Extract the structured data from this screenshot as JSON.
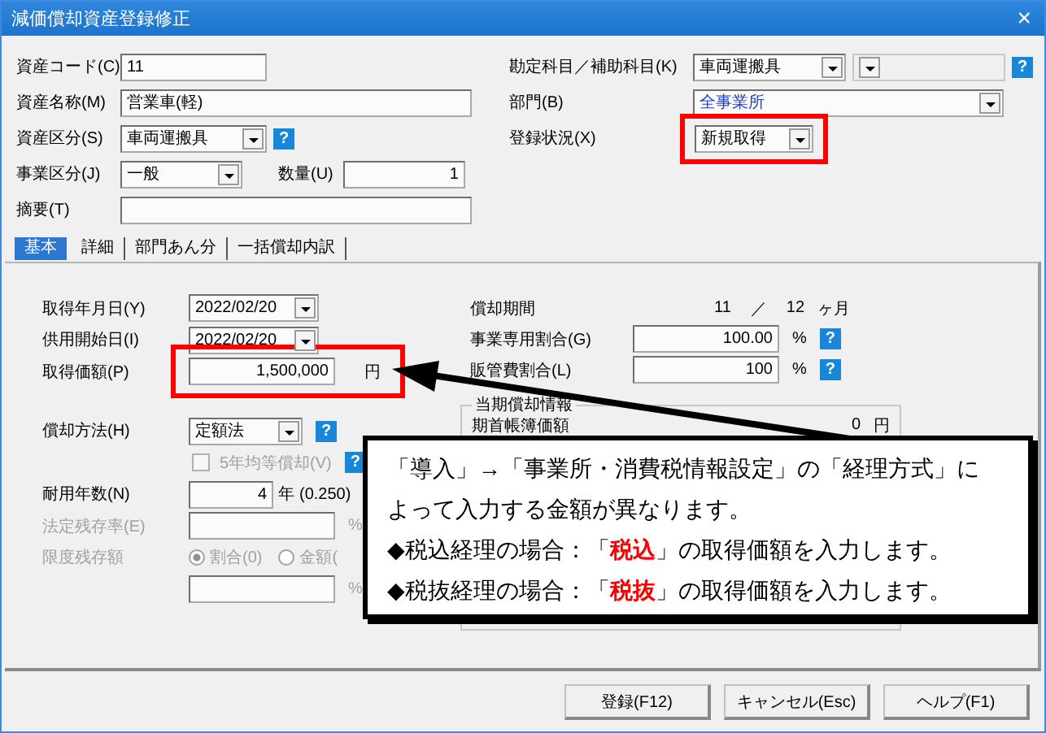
{
  "window": {
    "title": "減価償却資産登録修正",
    "close": "×"
  },
  "help_mark": "?",
  "form": {
    "asset_code": {
      "label": "資産コード(C)",
      "value": "11"
    },
    "asset_name": {
      "label": "資産名称(M)",
      "value": "営業車(軽)"
    },
    "asset_class": {
      "label": "資産区分(S)",
      "value": "車両運搬具"
    },
    "business_class": {
      "label": "事業区分(J)",
      "value": "一般"
    },
    "quantity": {
      "label": "数量(U)",
      "value": "1"
    },
    "memo": {
      "label": "摘要(T)"
    },
    "account": {
      "label": "勘定科目／補助科目(K)",
      "value": "車両運搬具",
      "sub_disabled": true
    },
    "department": {
      "label": "部門(B)",
      "value": "全事業所"
    },
    "status": {
      "label": "登録状況(X)",
      "value": "新規取得",
      "highlighted": true
    }
  },
  "tabs": [
    {
      "label": "基本",
      "selected": true
    },
    {
      "label": "詳細",
      "selected": false
    },
    {
      "label": "部門あん分",
      "selected": false
    },
    {
      "label": "一括償却内訳",
      "selected": false
    }
  ],
  "basic": {
    "acquired_date": {
      "label": "取得年月日(Y)",
      "value": "2022/02/20"
    },
    "start_date": {
      "label": "供用開始日(I)",
      "value": "2022/02/20"
    },
    "cost": {
      "label": "取得価額(P)",
      "value": "1,500,000",
      "unit": "円",
      "highlighted": true
    },
    "method": {
      "label": "償却方法(H)",
      "value": "定額法"
    },
    "five_year": {
      "label": "5年均等償却(V)",
      "checked": false,
      "disabled": true
    },
    "life": {
      "label": "耐用年数(N)",
      "value": "4",
      "unit": "年",
      "rate": "(0.250)"
    },
    "residual_rate": {
      "label": "法定残存率(E)",
      "unit": "%",
      "disabled": true
    },
    "limit": {
      "label": "限度残存額",
      "disabled": true,
      "unit": "%",
      "options": [
        {
          "label": "割合(0)",
          "selected": true
        },
        {
          "label": "金額(",
          "selected": false
        }
      ]
    },
    "period": {
      "label": "償却期間",
      "months": "11",
      "separator": "／",
      "total": "12",
      "unit": "ヶ月"
    },
    "business_ratio": {
      "label": "事業専用割合(G)",
      "value": "100.00",
      "unit": "%"
    },
    "admin_ratio": {
      "label": "販管費割合(L)",
      "value": "100",
      "unit": "%"
    },
    "current": {
      "title": "当期償却情報",
      "rows": [
        {
          "label": "期首帳簿価額",
          "value": "0",
          "unit": "円"
        }
      ]
    }
  },
  "callout": {
    "lines": [
      "「導入」→「事業所・消費税情報設定」の「経理方式」に",
      "よって入力する金額が異なります。",
      "◆税込経理の場合：「**税込**」の取得価額を入力します。",
      "◆税抜経理の場合：「**税抜**」の取得価額を入力します。"
    ]
  },
  "buttons": [
    "登録(F12)",
    "キャンセル(Esc)",
    "ヘルプ(F1)"
  ]
}
